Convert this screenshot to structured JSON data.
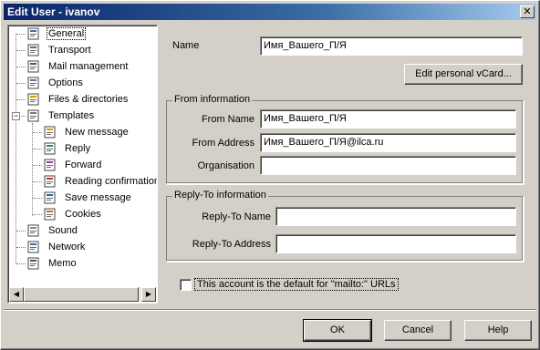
{
  "window": {
    "title": "Edit User - ivanov",
    "close_glyph": "✕"
  },
  "tree": {
    "items": [
      {
        "label": "General",
        "icon": "general-icon",
        "selected": true
      },
      {
        "label": "Transport",
        "icon": "transport-icon"
      },
      {
        "label": "Mail management",
        "icon": "mail-management-icon"
      },
      {
        "label": "Options",
        "icon": "options-icon"
      },
      {
        "label": "Files & directories",
        "icon": "files-directories-icon"
      },
      {
        "label": "Templates",
        "icon": "templates-icon",
        "expanded": true,
        "expander": "−"
      },
      {
        "label": "New message",
        "icon": "new-message-icon"
      },
      {
        "label": "Reply",
        "icon": "reply-icon"
      },
      {
        "label": "Forward",
        "icon": "forward-icon"
      },
      {
        "label": "Reading confirmation",
        "icon": "reading-confirmation-icon"
      },
      {
        "label": "Save message",
        "icon": "save-message-icon"
      },
      {
        "label": "Cookies",
        "icon": "cookies-icon"
      },
      {
        "label": "Sound",
        "icon": "sound-icon"
      },
      {
        "label": "Network",
        "icon": "network-icon"
      },
      {
        "label": "Memo",
        "icon": "memo-icon"
      }
    ],
    "scroll_left": "◀",
    "scroll_right": "▶"
  },
  "form": {
    "name_label": "Name",
    "name_value": "Имя_Вашего_П/Я",
    "vcard_button": "Edit personal vCard...",
    "from_group": {
      "title": "From information",
      "from_name_label": "From Name",
      "from_name_value": "Имя_Вашего_П/Я",
      "from_address_label": "From Address",
      "from_address_value": "Имя_Вашего_П/Я@ilca.ru",
      "organisation_label": "Organisation",
      "organisation_value": ""
    },
    "reply_group": {
      "title": "Reply-To information",
      "reply_name_label": "Reply-To Name",
      "reply_name_value": "",
      "reply_address_label": "Reply-To Address",
      "reply_address_value": ""
    },
    "default_checkbox_label": "This account is the default for \"mailto:\" URLs",
    "default_checked": false
  },
  "buttons": {
    "ok": "OK",
    "cancel": "Cancel",
    "help": "Help"
  },
  "colors": {
    "titlebar_start": "#0a246a",
    "titlebar_end": "#a6caf0",
    "face": "#d4d0c8"
  }
}
